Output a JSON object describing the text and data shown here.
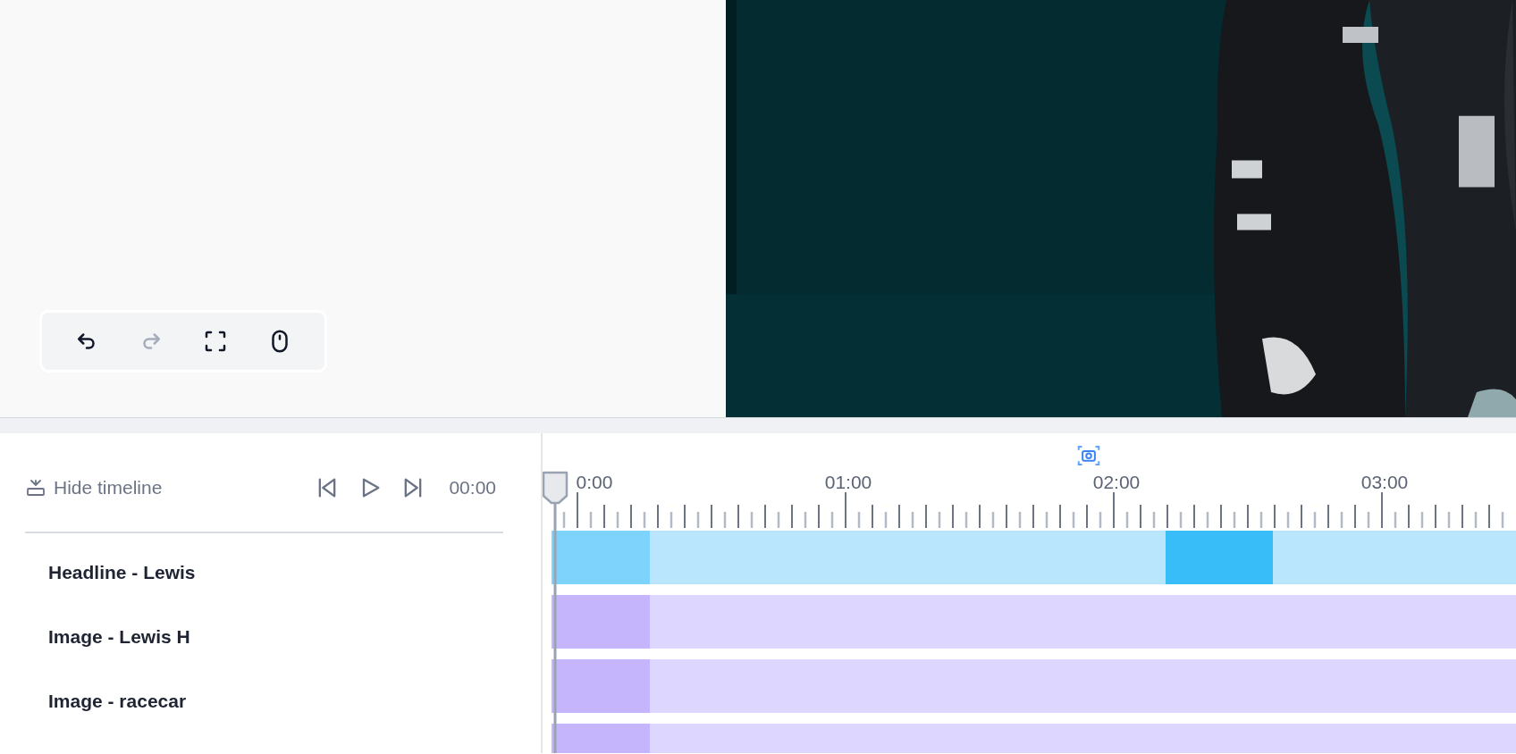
{
  "canvas": {
    "toolbar": [
      {
        "kind": "undo",
        "disabled": false
      },
      {
        "kind": "redo",
        "disabled": true
      },
      {
        "kind": "fullscreen",
        "disabled": false
      },
      {
        "kind": "mouse",
        "disabled": false
      }
    ]
  },
  "timeline": {
    "hide_button": "Hide timeline",
    "controls": [
      {
        "kind": "skip-back"
      },
      {
        "kind": "play"
      },
      {
        "kind": "skip-forward"
      }
    ],
    "time": "00:00",
    "ruler_labels": [
      "0:00",
      "01:00",
      "02:00",
      "03:00"
    ],
    "tracks": [
      {
        "name": "Headline - Lewis",
        "kind": "text",
        "segments": [
          {
            "kind": "intro",
            "selected": false
          },
          {
            "kind": "clip",
            "selected": false
          },
          {
            "kind": "clip",
            "selected": true
          },
          {
            "kind": "clip",
            "selected": false
          }
        ]
      },
      {
        "name": "Image - Lewis H",
        "segments": [
          {
            "kind": "intro",
            "selected": false
          },
          {
            "kind": "clip",
            "selected": false
          }
        ]
      },
      {
        "name": "Image - racecar",
        "segments": [
          {
            "kind": "intro",
            "selected": false
          },
          {
            "kind": "clip",
            "selected": false
          }
        ]
      },
      {
        "segments": [
          {
            "kind": "intro",
            "selected": false
          },
          {
            "kind": "clip",
            "selected": false
          }
        ]
      }
    ]
  }
}
